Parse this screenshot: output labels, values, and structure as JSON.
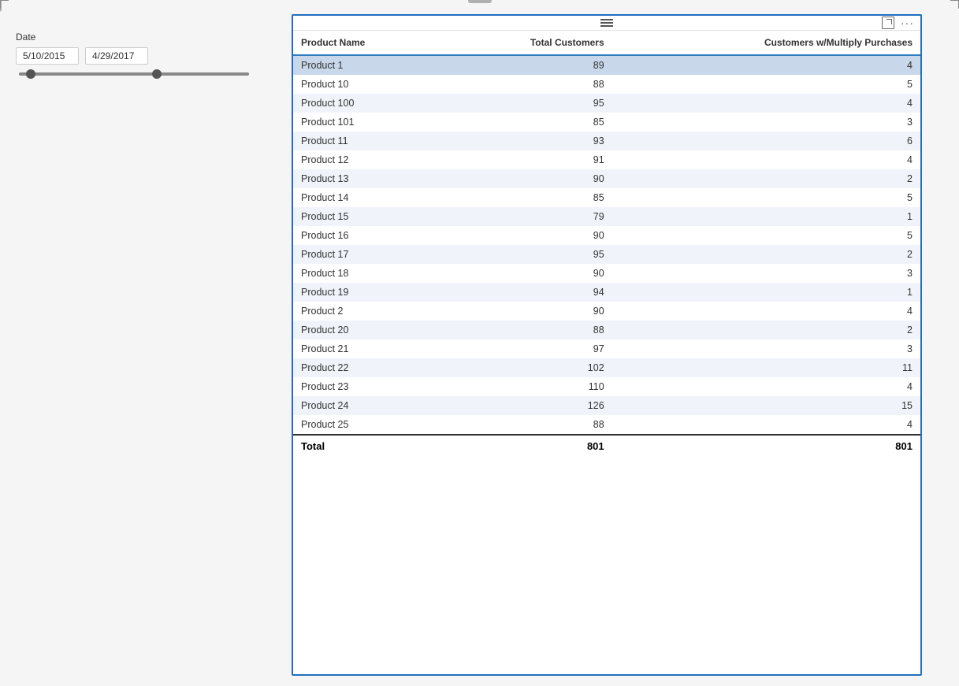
{
  "date_filter": {
    "label": "Date",
    "start_date": "5/10/2015",
    "end_date": "4/29/2017",
    "slider_left_pct": 5,
    "slider_right_pct": 60
  },
  "table": {
    "toolbar": {
      "menu_icon": "≡",
      "expand_icon": "expand",
      "more_icon": "..."
    },
    "columns": [
      {
        "key": "name",
        "label": "Product Name"
      },
      {
        "key": "total",
        "label": "Total Customers"
      },
      {
        "key": "multiply",
        "label": "Customers w/Multiply Purchases"
      }
    ],
    "rows": [
      {
        "name": "Product 1",
        "total": 89,
        "multiply": 4,
        "selected": true
      },
      {
        "name": "Product 10",
        "total": 88,
        "multiply": 5,
        "selected": false
      },
      {
        "name": "Product 100",
        "total": 95,
        "multiply": 4,
        "selected": false
      },
      {
        "name": "Product 101",
        "total": 85,
        "multiply": 3,
        "selected": false
      },
      {
        "name": "Product 11",
        "total": 93,
        "multiply": 6,
        "selected": false
      },
      {
        "name": "Product 12",
        "total": 91,
        "multiply": 4,
        "selected": false
      },
      {
        "name": "Product 13",
        "total": 90,
        "multiply": 2,
        "selected": false
      },
      {
        "name": "Product 14",
        "total": 85,
        "multiply": 5,
        "selected": false
      },
      {
        "name": "Product 15",
        "total": 79,
        "multiply": 1,
        "selected": false
      },
      {
        "name": "Product 16",
        "total": 90,
        "multiply": 5,
        "selected": false
      },
      {
        "name": "Product 17",
        "total": 95,
        "multiply": 2,
        "selected": false
      },
      {
        "name": "Product 18",
        "total": 90,
        "multiply": 3,
        "selected": false
      },
      {
        "name": "Product 19",
        "total": 94,
        "multiply": 1,
        "selected": false
      },
      {
        "name": "Product 2",
        "total": 90,
        "multiply": 4,
        "selected": false
      },
      {
        "name": "Product 20",
        "total": 88,
        "multiply": 2,
        "selected": false
      },
      {
        "name": "Product 21",
        "total": 97,
        "multiply": 3,
        "selected": false
      },
      {
        "name": "Product 22",
        "total": 102,
        "multiply": 11,
        "selected": false
      },
      {
        "name": "Product 23",
        "total": 110,
        "multiply": 4,
        "selected": false
      },
      {
        "name": "Product 24",
        "total": 126,
        "multiply": 15,
        "selected": false
      },
      {
        "name": "Product 25",
        "total": 88,
        "multiply": 4,
        "selected": false
      }
    ],
    "footer": {
      "label": "Total",
      "total": 801,
      "multiply": 801
    }
  }
}
